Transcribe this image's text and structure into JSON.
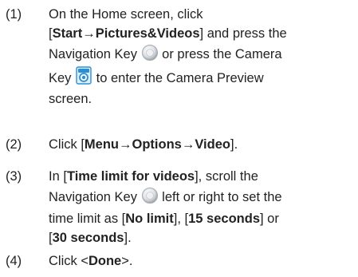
{
  "steps": [
    {
      "number": "(1)",
      "lines": [
        [
          "On the Home screen, click"
        ],
        [
          "[",
          "Start",
          "→",
          "Pictures&Videos",
          "] and press the"
        ],
        [
          "Navigation Key",
          "or press the Camera"
        ],
        [
          "Key",
          "to enter the Camera Preview"
        ],
        [
          "screen."
        ]
      ]
    },
    {
      "number": "(2)",
      "parts": [
        "Click [",
        "Menu",
        "→",
        "Options",
        "→",
        "Video",
        "]."
      ]
    },
    {
      "number": "(3)",
      "lines": [
        [
          "In [",
          "Time limit for videos",
          "], scroll the"
        ],
        [
          "Navigation Key",
          "left or right to set the"
        ],
        [
          "time limit as [",
          "No limit",
          "], [",
          "15 seconds",
          "] or"
        ],
        [
          "[",
          "30 seconds",
          "]."
        ]
      ]
    },
    {
      "number": "(4)",
      "parts": [
        "Click <",
        "Done",
        ">."
      ]
    }
  ],
  "icons": {
    "navigation_key": "navigation-key-icon",
    "camera_key": "camera-key-icon",
    "camera_color": "#2b8fd6",
    "nav_color": "#b9bec4"
  }
}
